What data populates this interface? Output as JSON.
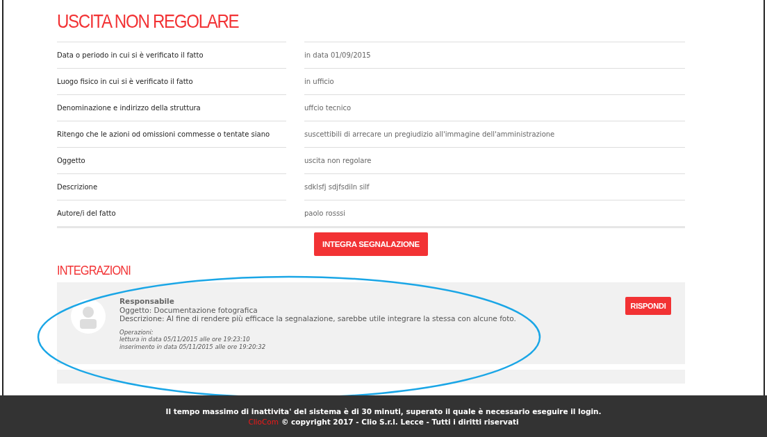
{
  "title": "USCITA NON REGOLARE",
  "fields": [
    {
      "label": "Data o periodo in cui si è verificato il fatto",
      "value": "in data 01/09/2015"
    },
    {
      "label": "Luogo fisico in cui si è verificato il fatto",
      "value": "in ufficio"
    },
    {
      "label": "Denominazione e indirizzo della struttura",
      "value": "uffcio tecnico"
    },
    {
      "label": "Ritengo che le azioni od omissioni commesse o tentate siano",
      "value": "suscettibili di arrecare un pregiudizio all'immagine dell'amministrazione"
    },
    {
      "label": "Oggetto",
      "value": "uscita non regolare"
    },
    {
      "label": "Descrizione",
      "value": "sdklsfj sdjfsdiln silf"
    },
    {
      "label": "Autore/i del fatto",
      "value": "paolo rosssi"
    }
  ],
  "integrate_button": "INTEGRA SEGNALAZIONE",
  "integrations": {
    "heading": "INTEGRAZIONI",
    "items": [
      {
        "author": "Responsabile",
        "subject": "Oggetto: Documentazione fotografica",
        "description": "Descrizione: Al fine di rendere più efficace la segnalazione, sarebbe utile integrare la stessa con alcune foto.",
        "operations_label": "Operazioni:",
        "operations": [
          "lettura in data 05/11/2015 alle ore 19:23:10",
          "inserimento in data 05/11/2015 alle ore 19:20:32"
        ],
        "reply_button": "RISPONDI"
      }
    ]
  },
  "footer": {
    "notice": "Il tempo massimo di inattivita' del sistema è di 30 minuti, superato il quale è necessario eseguire il login.",
    "brand": "ClioCom",
    "copyright": "© copyright 2017 - Clio S.r.l. Lecce - Tutti i diritti riservati"
  }
}
